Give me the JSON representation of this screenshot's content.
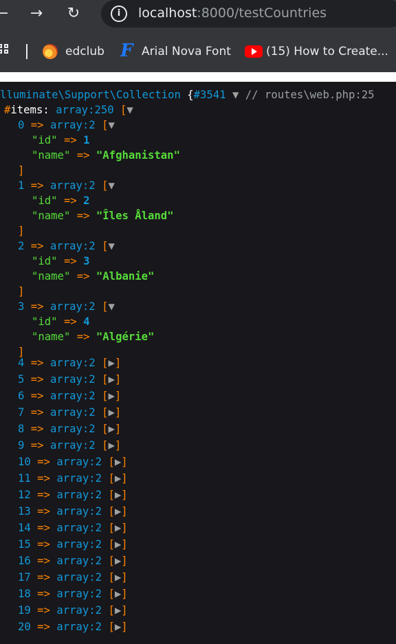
{
  "browser": {
    "nav": {
      "back": "back-arrow-icon",
      "forward": "forward-arrow-icon",
      "reload": "reload-icon"
    },
    "address": {
      "host": "localhost",
      "rest": ":8000/testCountries"
    },
    "bookmarks": [
      {
        "label": "edclub",
        "icon": "fire-icon"
      },
      {
        "label": "Arial Nova Font",
        "icon": "f-logo-icon"
      },
      {
        "label": "(15) How to Create...",
        "icon": "youtube-icon"
      }
    ]
  },
  "dump": {
    "header": {
      "class_name": "lluminate\\Support\\Collection",
      "open_brace": "{",
      "ref": "#3541",
      "toggle": "▼",
      "comment": "// routes\\web.php:25"
    },
    "items_prop": {
      "hash": "#",
      "name": "items",
      "colon": ":",
      "type": "array:250",
      "open": "[",
      "toggle": "▼"
    },
    "arrow": "=>",
    "expanded": [
      {
        "index": "0",
        "type": "array:2",
        "toggle": "▼",
        "id_key": "\"id\"",
        "id": "1",
        "name_key": "\"name\"",
        "name": "\"Afghanistan\""
      },
      {
        "index": "1",
        "type": "array:2",
        "toggle": "▼",
        "id_key": "\"id\"",
        "id": "2",
        "name_key": "\"name\"",
        "name": "\"Îles Åland\""
      },
      {
        "index": "2",
        "type": "array:2",
        "toggle": "▼",
        "id_key": "\"id\"",
        "id": "3",
        "name_key": "\"name\"",
        "name": "\"Albanie\""
      },
      {
        "index": "3",
        "type": "array:2",
        "toggle": "▼",
        "id_key": "\"id\"",
        "id": "4",
        "name_key": "\"name\"",
        "name": "\"Algérie\""
      }
    ],
    "collapsed": [
      {
        "index": "4",
        "type": "array:2",
        "toggle": "▶"
      },
      {
        "index": "5",
        "type": "array:2",
        "toggle": "▶"
      },
      {
        "index": "6",
        "type": "array:2",
        "toggle": "▶"
      },
      {
        "index": "7",
        "type": "array:2",
        "toggle": "▶"
      },
      {
        "index": "8",
        "type": "array:2",
        "toggle": "▶"
      },
      {
        "index": "9",
        "type": "array:2",
        "toggle": "▶"
      },
      {
        "index": "10",
        "type": "array:2",
        "toggle": "▶"
      },
      {
        "index": "11",
        "type": "array:2",
        "toggle": "▶"
      },
      {
        "index": "12",
        "type": "array:2",
        "toggle": "▶"
      },
      {
        "index": "13",
        "type": "array:2",
        "toggle": "▶"
      },
      {
        "index": "14",
        "type": "array:2",
        "toggle": "▶"
      },
      {
        "index": "15",
        "type": "array:2",
        "toggle": "▶"
      },
      {
        "index": "16",
        "type": "array:2",
        "toggle": "▶"
      },
      {
        "index": "17",
        "type": "array:2",
        "toggle": "▶"
      },
      {
        "index": "18",
        "type": "array:2",
        "toggle": "▶"
      },
      {
        "index": "19",
        "type": "array:2",
        "toggle": "▶"
      },
      {
        "index": "20",
        "type": "array:2",
        "toggle": "▶"
      }
    ],
    "open_bracket": "[",
    "close_bracket": "]"
  },
  "colors": {
    "background": "#18171b",
    "key_green": "#56db3a",
    "number_blue": "#1299da",
    "bracket_orange": "#ff8400"
  }
}
